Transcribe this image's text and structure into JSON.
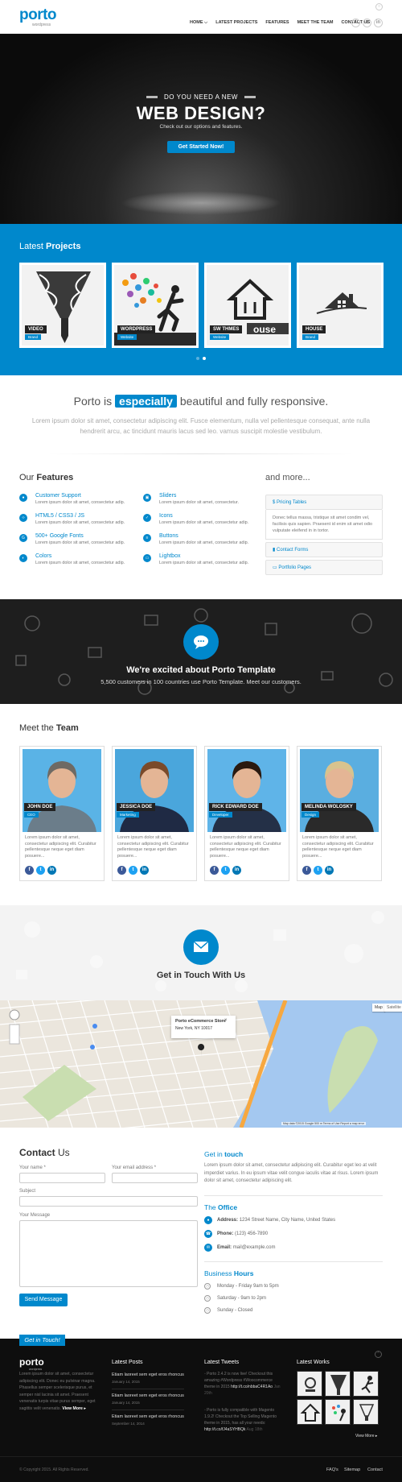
{
  "header": {
    "logo": "porto",
    "logo_sub": "wordpress",
    "nav": [
      "HOME ⌵",
      "LATEST PROJECTS",
      "FEATURES",
      "MEET THE TEAM",
      "CONTACT US"
    ],
    "social": [
      "f",
      "t",
      "in"
    ]
  },
  "hero": {
    "pre": "DO YOU NEED A NEW",
    "title": "WEB DESIGN?",
    "subtitle": "Check out our options and features.",
    "button": "Get Started Now!"
  },
  "projects": {
    "heading_light": "Latest",
    "heading_bold": "Projects",
    "items": [
      {
        "title": "VIDEO",
        "category": "Brand"
      },
      {
        "title": "WORDPRESS",
        "category": "Website"
      },
      {
        "title": "SW THMES",
        "category": "Website"
      },
      {
        "title": "HOUSE",
        "category": "Brand"
      }
    ],
    "slide_active": 2,
    "slide_count": 2
  },
  "slogan": {
    "before": "Porto is",
    "highlight": "especially",
    "after": "beautiful and fully responsive.",
    "lead": "Lorem ipsum dolor sit amet, consectetur adipiscing elit. Fusce elementum, nulla vel pellentesque consequat, ante nulla hendrerit arcu, ac tincidunt mauris lacus sed leo. vamus suscipit molestie vestibulum."
  },
  "features": {
    "heading_light": "Our",
    "heading_bold": "Features",
    "items": [
      {
        "title": "Customer Support",
        "desc": "Lorem ipsum dolor sit amet, consectetur adip.",
        "icon": "support-icon",
        "glyph": "●"
      },
      {
        "title": "HTML5 / CSS3 / JS",
        "desc": "Lorem ipsum dolor sit amet, consectetur adip.",
        "icon": "code-icon",
        "glyph": "‹›"
      },
      {
        "title": "500+ Google Fonts",
        "desc": "Lorem ipsum dolor sit amet, consectetur adip.",
        "icon": "google-icon",
        "glyph": "G"
      },
      {
        "title": "Colors",
        "desc": "Lorem ipsum dolor sit amet, consectetur adip.",
        "icon": "adjust-icon",
        "glyph": "◐"
      },
      {
        "title": "Sliders",
        "desc": "Lorem ipsum dolor sit amet, consectetur.",
        "icon": "film-icon",
        "glyph": "▣"
      },
      {
        "title": "Icons",
        "desc": "Lorem ipsum dolor sit amet, consectetur adip.",
        "icon": "check-icon",
        "glyph": "✓"
      },
      {
        "title": "Buttons",
        "desc": "Lorem ipsum dolor sit amet, consectetur adip.",
        "icon": "bars-icon",
        "glyph": "≡"
      },
      {
        "title": "Lightbox",
        "desc": "Lorem ipsum dolor sit amet, consectetur adip.",
        "icon": "desktop-icon",
        "glyph": "▭"
      }
    ],
    "more_heading": "and more...",
    "accordion": [
      {
        "title": "$  Pricing Tables",
        "icon": "dollar-icon"
      },
      {
        "title": "Contact Forms",
        "icon": "comment-icon"
      },
      {
        "title": "Portfolio Pages",
        "icon": "laptop-icon"
      }
    ],
    "accordion_body": "Donec tellus massa, tristique sit amet condim vel, facilisis quis sapien. Praesent id enim sit amet odio vulputate eleifend in in tortor."
  },
  "excited": {
    "title": "We're excited about Porto Template",
    "subtitle": "5,500 customers in 100 countries use Porto Template. Meet our customers."
  },
  "team": {
    "heading_light": "Meet the",
    "heading_bold": "Team",
    "members": [
      {
        "name": "JOHN DOE",
        "role": "CEO",
        "bio": "Lorem ipsum dolor sit amet, consectetur adipiscing elit. Curabitur pellentesque neque eget diam posuere..."
      },
      {
        "name": "JESSICA DOE",
        "role": "Marketing",
        "bio": "Lorem ipsum dolor sit amet, consectetur adipiscing elit. Curabitur pellentesque neque eget diam posuere..."
      },
      {
        "name": "RICK EDWARD DOE",
        "role": "Developer",
        "bio": "Lorem ipsum dolor sit amet, consectetur adipiscing elit. Curabitur pellentesque neque eget diam posuere..."
      },
      {
        "name": "MELINDA WOLOSKY",
        "role": "Design",
        "bio": "Lorem ipsum dolor sit amet, consectetur adipiscing elit. Curabitur pellentesque neque eget diam posuere..."
      }
    ],
    "social": [
      "f",
      "t",
      "in"
    ]
  },
  "touch": {
    "title": "Get in Touch With Us"
  },
  "map": {
    "popup_title": "Porto eCommerce Store",
    "popup_addr": "New York, NY 10017",
    "popup_close": "×",
    "tab_map": "Map",
    "tab_sat": "Satellite",
    "attribution": "Map data ©2015 Google   500 m    Terms of Use   Report a map error"
  },
  "contact": {
    "heading_bold": "Contact",
    "heading_light": "Us",
    "name_label": "Your name *",
    "email_label": "Your email address *",
    "subject_label": "Subject",
    "message_label": "Your Message",
    "send": "Send Message",
    "touch_light": "Get in",
    "touch_bold": "touch",
    "touch_text": "Lorem ipsum dolor sit amet, consectetur adipiscing elit. Curabitur eget leo at velit imperdiet varius. In eu ipsum vitae velit congue iaculis vitae at risus. Lorem ipsum dolor sit amet, consectetur adipiscing elit.",
    "office_light": "The",
    "office_bold": "Office",
    "address_label": "Address:",
    "address": "1234 Street Name, City Name, United States",
    "phone_label": "Phone:",
    "phone": "(123) 456-7890",
    "email_label2": "Email:",
    "email": "mail@example.com",
    "hours_light": "Business",
    "hours_bold": "Hours",
    "hours": [
      "Monday - Friday 9am to 5pm",
      "Saturday - 9am to 2pm",
      "Sunday - Closed"
    ]
  },
  "footer": {
    "ribbon": "Get in Touch!",
    "logo": "porto",
    "logo_sub": "wordpress",
    "about": "Lorem ipsum dolor sit amet, consectetur adipiscing elit. Donec eu pulvinar magna. Phasellus semper scelerisque purus, et semper nisl lacinia sit amet. Praesent venenatis turpis vitae purus semper, eget sagittis velit venenatis.",
    "view_more": "View More ▸",
    "posts_heading": "Latest Posts",
    "posts": [
      {
        "title": "Etiam laoreet sem eget eros rhoncus",
        "date": "January 14, 2015"
      },
      {
        "title": "Etiam laoreet sem eget eros rhoncus",
        "date": "January 14, 2015"
      },
      {
        "title": "Etiam laoreet sem eget eros rhoncus",
        "date": "September 14, 2014"
      }
    ],
    "tweets_heading": "Latest Tweets",
    "tweets": [
      {
        "text": "Porto 2.4.2 is now live! Checkout this amazing #Wordpress #Woocommerce theme in 2015",
        "link": "http://t.co/nbbaC4R1Ao",
        "date": "Jan 20th"
      },
      {
        "text": "Porto is fully compatible with Magento 1.9.2! Checkout the Top Selling Magento theme in 2015, has all your needs:",
        "link": "http://t.co/fJ4aSYHBQk",
        "date": "Aug 18th"
      }
    ],
    "works_heading": "Latest Works",
    "works_more": "View More ▸",
    "copyright": "© Copyright 2015. All Rights Reserved.",
    "links": [
      "FAQ's",
      "Sitemap",
      "Contact"
    ]
  },
  "colors": {
    "accent": "#0088cc",
    "dark": "#1e1e1e",
    "footer": "#0e0e0e"
  }
}
